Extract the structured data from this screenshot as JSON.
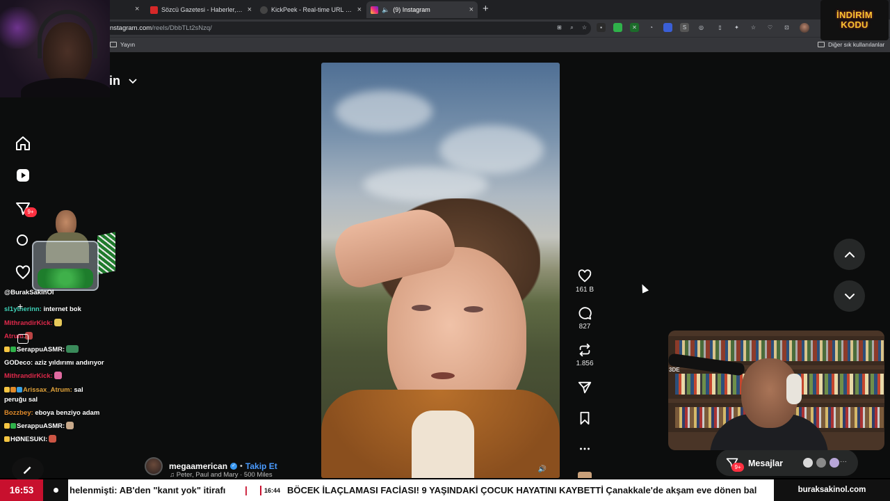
{
  "browser": {
    "tabs": [
      {
        "title": "Sözcü Gazetesi - Haberler, son dakika",
        "color": "#d62828",
        "active": false
      },
      {
        "title": "KickPeek - Real-time URL Crawler f",
        "color": "#444444",
        "active": false
      },
      {
        "title": "(9) Instagram",
        "color": "#e1306c",
        "active": true
      }
    ],
    "url_host": "nstagram.com",
    "url_path": "/reels/DbbTLt2sNzq/",
    "bookmarks": {
      "left": "Yayın",
      "right": "Diğer sık kullanılanlar"
    }
  },
  "instagram": {
    "logo_partial": "in",
    "sidebar_badge": "9+",
    "post": {
      "author": "megaamerican",
      "follow_label": "Takip Et",
      "music": "Peter, Paul and Mary · 500 Miles",
      "likes": "161 B",
      "comments": "827",
      "reposts": "1.856"
    },
    "messages": {
      "label": "Mesajlar",
      "badge": "9+"
    }
  },
  "chat": [
    {
      "user": "@BurakSakinOl",
      "user_color": "#ffffff",
      "msg": ""
    },
    {
      "user": "sl1ytherinn:",
      "user_color": "#3ed1b7",
      "msg": " internet bok"
    },
    {
      "user": "MithrandirKick:",
      "user_color": "#e0294b",
      "msg": ""
    },
    {
      "user": "Atrum",
      "user_color": "#e0294b",
      "msg": ""
    },
    {
      "user": "SerappuASMR:",
      "user_color": "#ffffff",
      "msg": ""
    },
    {
      "user": "GODeco:",
      "user_color": "#ffffff",
      "msg": " aziz yıldırımı andırıyor"
    },
    {
      "user": "MithrandirKick:",
      "user_color": "#e0294b",
      "msg": ""
    },
    {
      "user": "Arissax_Atrum:",
      "user_color": "#e0a23a",
      "msg": " sal"
    },
    {
      "user": "",
      "user_color": "#ffffff",
      "msg": "peruğu sal"
    },
    {
      "user": "Bozzbey:",
      "user_color": "#e08a2a",
      "msg": " eboya benziyo adam"
    },
    {
      "user": "SerappuASMR:",
      "user_color": "#ffffff",
      "msg": ""
    },
    {
      "user": "HØNESUKI:",
      "user_color": "#ffffff",
      "msg": ""
    }
  ],
  "overlay": {
    "promo_line1": "İNDİRİM",
    "promo_line2": "KODU",
    "mic_label": "3DE"
  },
  "ticker": {
    "clock": "16:53",
    "headline1": "helenmişti: AB'den \"kanıt yok\" itirafı",
    "time2": "16:44",
    "headline2": "BÖCEK İLAÇLAMASI FACİASI! 9 YAŞINDAKİ ÇOCUK HAYATINI KAYBETTİ Çanakkale'de akşam eve dönen bal",
    "site": "buraksakinol.com"
  }
}
